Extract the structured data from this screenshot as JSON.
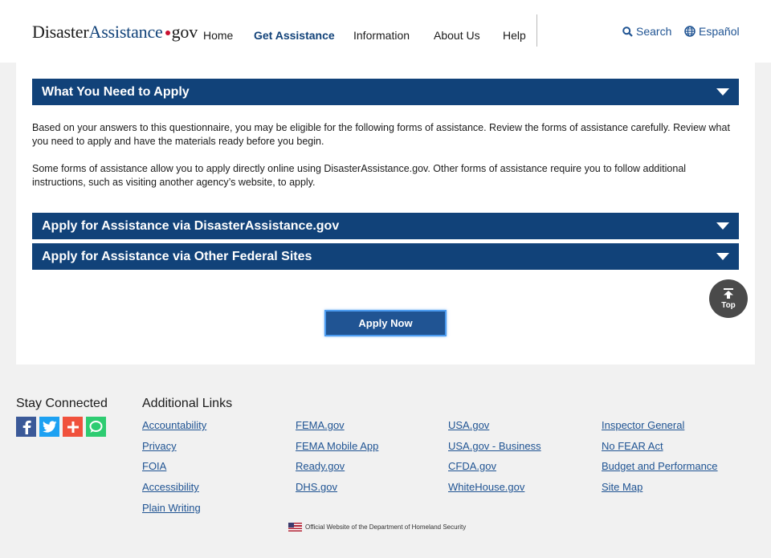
{
  "header": {
    "logo": {
      "part1": "Disaster",
      "part2": "Assistance",
      "part3": "gov"
    },
    "nav": [
      "Home",
      "Get Assistance",
      "Information",
      "About Us",
      "Help"
    ],
    "active_nav": "Get Assistance",
    "search_label": "Search",
    "language_label": "Español"
  },
  "main": {
    "section1_title": "What You Need to Apply",
    "para1": "Based on your answers to this questionnaire, you may be eligible for the following forms of assistance. Review the forms of assistance carefully. Review what you need to apply and have the materials ready before you begin.",
    "para2": "Some forms of assistance allow you to apply directly online using DisasterAssistance.gov. Other forms of assistance require you to follow additional instructions, such as visiting another agency’s website, to apply.",
    "section2_title": "Apply for Assistance via DisasterAssistance.gov",
    "section3_title": "Apply for Assistance via Other Federal Sites",
    "apply_button": "Apply Now",
    "top_button": "Top"
  },
  "footer": {
    "stay_connected": "Stay Connected",
    "social_icons": [
      "facebook-icon",
      "twitter-icon",
      "addthis-icon",
      "chat-icon"
    ],
    "social_colors": [
      "#3b5998",
      "#1da1f2",
      "#f0513c",
      "#2ecc71"
    ],
    "additional_links_title": "Additional Links",
    "col1": [
      "Accountability",
      "Privacy",
      "FOIA",
      "Accessibility",
      "Plain Writing"
    ],
    "col2": [
      "FEMA.gov",
      "FEMA Mobile App",
      "Ready.gov",
      "DHS.gov"
    ],
    "col3": [
      "USA.gov",
      "USA.gov - Business",
      "CFDA.gov",
      "WhiteHouse.gov"
    ],
    "col4": [
      "Inspector General",
      "No FEAR Act",
      "Budget and Performance",
      "Site Map"
    ],
    "official": "Official Website of the Department of Homeland Security"
  },
  "colors": {
    "primary": "#114279",
    "link": "#205493",
    "button_focus": "#4b9bf0"
  }
}
